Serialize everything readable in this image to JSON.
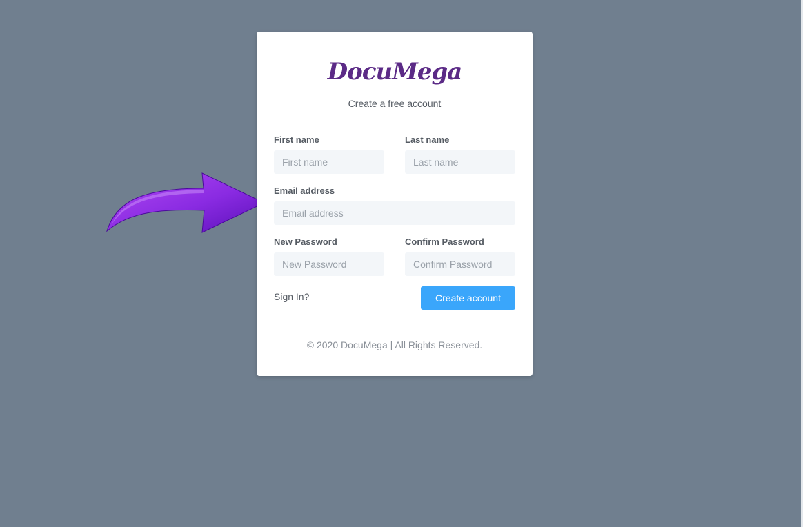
{
  "brand": {
    "logo_text": "DocuMega",
    "subtitle": "Create a free account"
  },
  "form": {
    "first_name": {
      "label": "First name",
      "placeholder": "First name",
      "value": ""
    },
    "last_name": {
      "label": "Last name",
      "placeholder": "Last name",
      "value": ""
    },
    "email": {
      "label": "Email address",
      "placeholder": "Email address",
      "value": ""
    },
    "new_password": {
      "label": "New Password",
      "placeholder": "New Password",
      "value": ""
    },
    "confirm_password": {
      "label": "Confirm Password",
      "placeholder": "Confirm Password",
      "value": ""
    }
  },
  "actions": {
    "signin_label": "Sign In?",
    "create_label": "Create account"
  },
  "footer": {
    "copyright": "© 2020 DocuMega | All Rights Reserved."
  },
  "annotation": {
    "icon": "arrow-right-icon",
    "color": "#8a2be2"
  },
  "colors": {
    "background": "#707f8f",
    "primary": "#3aa6fb",
    "logo": "#5b2a86"
  }
}
